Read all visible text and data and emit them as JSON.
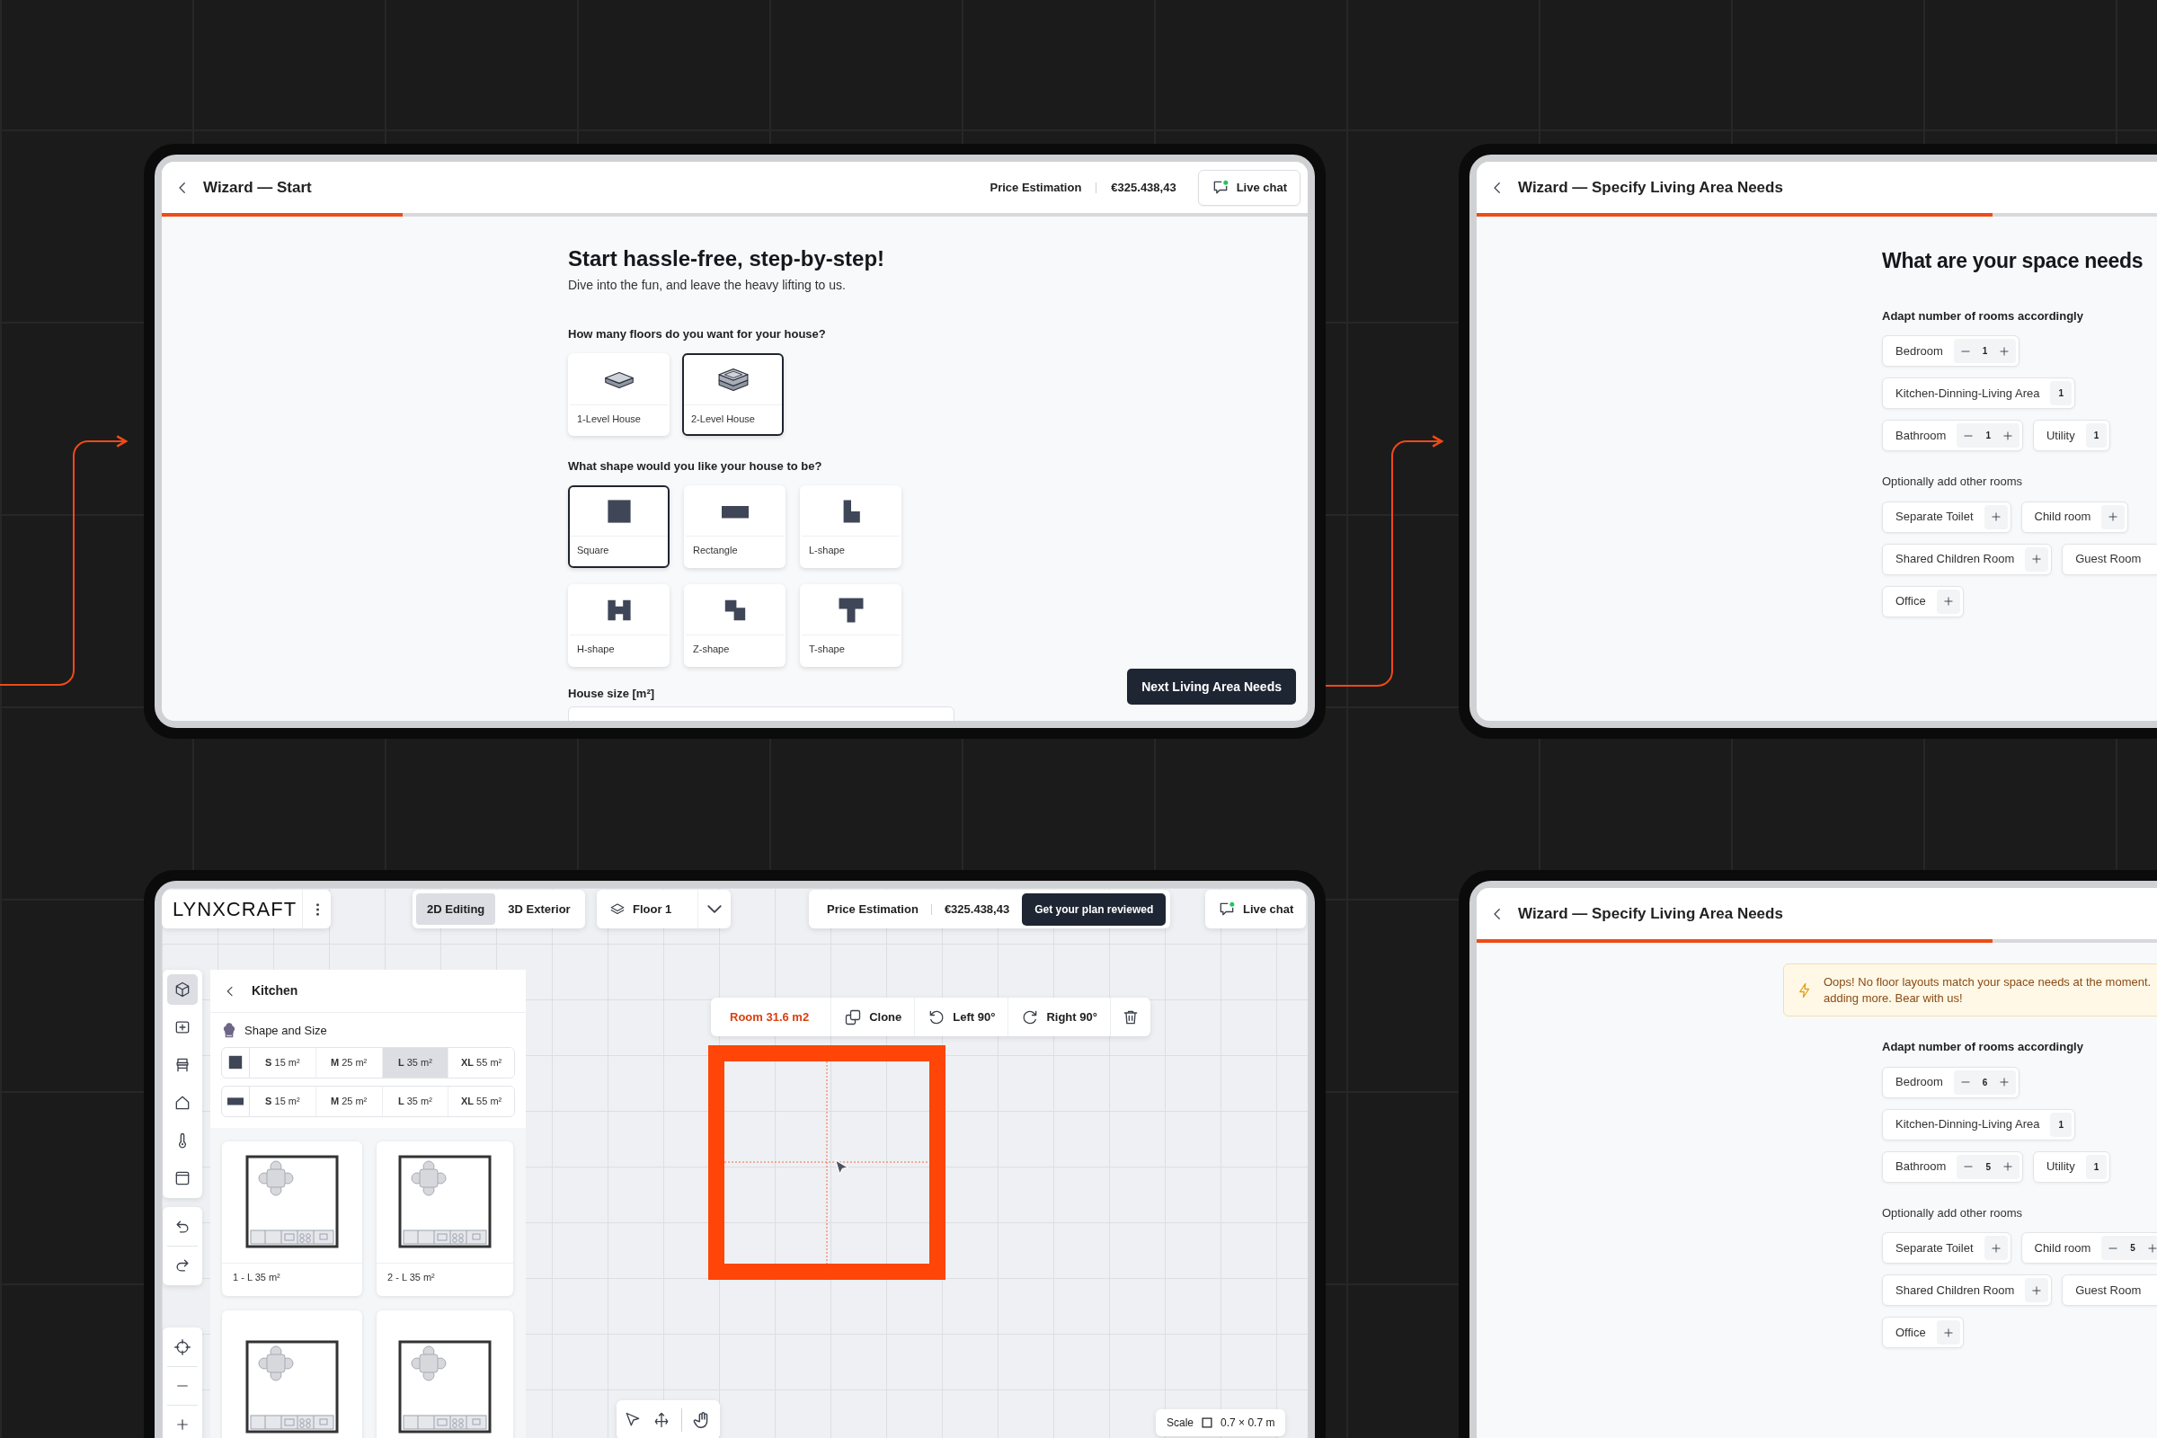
{
  "wizard_start": {
    "header": {
      "title": "Wizard — Start",
      "price_label": "Price Estimation",
      "price": "€325.438,43",
      "chat": "Live chat"
    },
    "progress": {
      "level": 0.21
    },
    "heading": "Start hassle-free, step-by-step!",
    "subheading": "Dive into the fun, and leave the heavy lifting to us.",
    "floors": {
      "question": "How many floors do you want for your house?",
      "options": [
        {
          "label": "1-Level House",
          "kind": "one",
          "selected": false
        },
        {
          "label": "2-Level House",
          "kind": "two",
          "selected": true
        }
      ]
    },
    "shapes": {
      "question": "What shape would you like your house to be?",
      "options": [
        {
          "label": "Square",
          "kind": "square",
          "selected": true
        },
        {
          "label": "Rectangle",
          "kind": "rectangle",
          "selected": false
        },
        {
          "label": "L-shape",
          "kind": "l",
          "selected": false
        },
        {
          "label": "H-shape",
          "kind": "h",
          "selected": false
        },
        {
          "label": "Z-shape",
          "kind": "z",
          "selected": false
        },
        {
          "label": "T-shape",
          "kind": "t",
          "selected": false
        }
      ]
    },
    "size_field": {
      "label": "House size [m²]"
    },
    "next_button": "Next Living Area Needs"
  },
  "wizard_needs": {
    "header": {
      "title": "Wizard — Specify Living Area Needs"
    },
    "progress": {
      "level": 0.45
    },
    "heading": "What are your space needs",
    "required": {
      "label": "Adapt number of rooms accordingly",
      "rows": [
        [
          {
            "name": "Bedroom",
            "kind": "stepper",
            "count": "1"
          }
        ],
        [
          {
            "name": "Kitchen-Dinning-Living Area",
            "kind": "count",
            "count": "1"
          }
        ],
        [
          {
            "name": "Bathroom",
            "kind": "stepper",
            "count": "1"
          },
          {
            "name": "Utility",
            "kind": "count",
            "count": "1"
          }
        ]
      ]
    },
    "optional": {
      "label": "Optionally add other rooms",
      "rows": [
        [
          {
            "name": "Separate Toilet",
            "kind": "add"
          },
          {
            "name": "Child room",
            "kind": "add"
          }
        ],
        [
          {
            "name": "Shared Children Room",
            "kind": "add"
          },
          {
            "name": "Guest Room",
            "kind": "plain"
          }
        ],
        [
          {
            "name": "Office",
            "kind": "add"
          }
        ]
      ]
    }
  },
  "editor": {
    "brand": "LYNXCRAFT",
    "modes": [
      {
        "label": "2D Editing",
        "selected": true
      },
      {
        "label": "3D Exterior",
        "selected": false
      }
    ],
    "floor": "Floor 1",
    "price_label": "Price Estimation",
    "price": "€325.438,43",
    "review_button": "Get your plan reviewed",
    "chat": "Live chat",
    "tools": [
      {
        "kind": "cube",
        "selected": true
      },
      {
        "kind": "add",
        "selected": false
      },
      {
        "kind": "chair",
        "selected": false
      },
      {
        "kind": "house",
        "selected": false
      },
      {
        "kind": "thermometer",
        "selected": false
      },
      {
        "kind": "window",
        "selected": false
      }
    ],
    "panel": {
      "title": "Kitchen",
      "section": "Shape and Size",
      "sizes": [
        {
          "kind": "square",
          "options": [
            {
              "label": "**S** 15 m²",
              "selected": false
            },
            {
              "label": "**M** 25 m²",
              "selected": false
            },
            {
              "label": "**L** 35 m²",
              "selected": true
            },
            {
              "label": "**XL** 55 m²",
              "selected": false
            }
          ]
        },
        {
          "kind": "rectangle",
          "options": [
            {
              "label": "**S** 15 m²",
              "selected": false
            },
            {
              "label": "**M** 25 m²",
              "selected": false
            },
            {
              "label": "**L** 35 m²",
              "selected": false
            },
            {
              "label": "**XL** 55 m²",
              "selected": false
            }
          ]
        }
      ],
      "layouts": [
        {
          "kind": "plan",
          "label": "1 - L 35 m²"
        },
        {
          "kind": "plan",
          "label": "2 - L 35 m²"
        },
        {
          "kind": "plan"
        },
        {
          "kind": "plan"
        }
      ]
    },
    "room_toolbar": {
      "room": "Room 31.6 m2",
      "actions": [
        {
          "kind": "clone",
          "label": "Clone"
        },
        {
          "kind": "rotate_left",
          "label": "Left 90°"
        },
        {
          "kind": "rotate_right",
          "label": "Right 90°"
        },
        {
          "kind": "delete"
        }
      ]
    },
    "scale": {
      "label": "Scale",
      "value": "0.7 × 0.7 m"
    }
  },
  "wizard_needs_alert": {
    "header": {
      "title": "Wizard — Specify Living Area Needs"
    },
    "progress": {
      "level": 0.45
    },
    "alert": {
      "lines": [
        "Oops! No floor layouts match your space needs at the moment.",
        "adding more. Bear with us!"
      ]
    },
    "required": {
      "label": "Adapt number of rooms accordingly",
      "rows": [
        [
          {
            "name": "Bedroom",
            "kind": "stepper",
            "count": "6"
          }
        ],
        [
          {
            "name": "Kitchen-Dinning-Living Area",
            "kind": "count",
            "count": "1"
          }
        ],
        [
          {
            "name": "Bathroom",
            "kind": "stepper",
            "count": "5"
          },
          {
            "name": "Utility",
            "kind": "count",
            "count": "1"
          }
        ]
      ]
    },
    "optional": {
      "label": "Optionally add other rooms",
      "rows": [
        [
          {
            "name": "Separate Toilet",
            "kind": "add"
          },
          {
            "name": "Child room",
            "kind": "stepper",
            "count": "5"
          }
        ],
        [
          {
            "name": "Shared Children Room",
            "kind": "add"
          },
          {
            "name": "Guest Room",
            "kind": "plain"
          }
        ],
        [
          {
            "name": "Office",
            "kind": "add"
          }
        ]
      ]
    }
  }
}
